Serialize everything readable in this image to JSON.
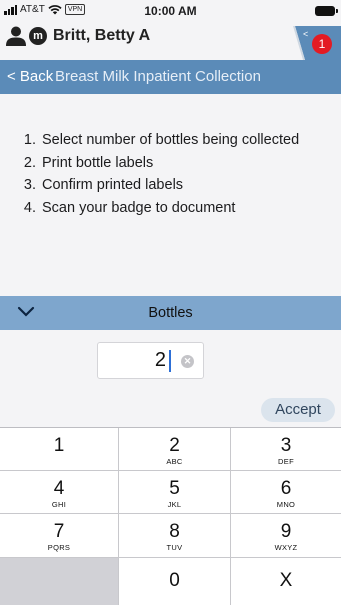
{
  "status_bar": {
    "carrier": "AT&T",
    "vpn": "VPN",
    "time": "10:00 AM"
  },
  "patient": {
    "name": "Britt, Betty A",
    "badge_letter": "m",
    "notification_count": "1"
  },
  "nav": {
    "back_label": "< Back",
    "title": "Breast Milk Inpatient Collection"
  },
  "steps": [
    {
      "num": "1.",
      "text": "Select number of bottles being collected"
    },
    {
      "num": "2.",
      "text": "Print bottle labels"
    },
    {
      "num": "3.",
      "text": "Confirm printed labels"
    },
    {
      "num": "4.",
      "text": "Scan your badge to document"
    }
  ],
  "bottles": {
    "label": "Bottles",
    "value": "2",
    "accept_label": "Accept"
  },
  "keypad": {
    "keys": [
      {
        "digit": "1",
        "letters": ""
      },
      {
        "digit": "2",
        "letters": "ABC"
      },
      {
        "digit": "3",
        "letters": "DEF"
      },
      {
        "digit": "4",
        "letters": "GHI"
      },
      {
        "digit": "5",
        "letters": "JKL"
      },
      {
        "digit": "6",
        "letters": "MNO"
      },
      {
        "digit": "7",
        "letters": "PQRS"
      },
      {
        "digit": "8",
        "letters": "TUV"
      },
      {
        "digit": "9",
        "letters": "WXYZ"
      }
    ],
    "zero": "0",
    "clear": "X"
  },
  "colors": {
    "nav_bar": "#5b8bb8",
    "section_bar": "#7ea6cd",
    "notification": "#e31b23",
    "caret": "#2d6fd6"
  }
}
